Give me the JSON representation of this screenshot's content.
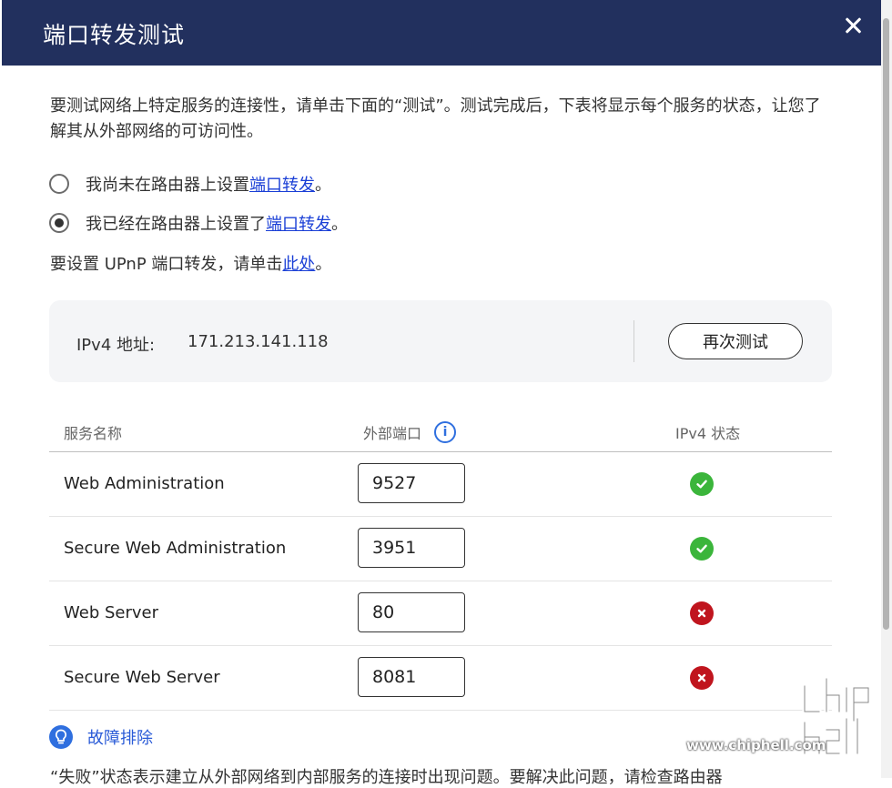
{
  "dialog": {
    "title": "端口转发测试"
  },
  "description": "要测试网络上特定服务的连接性，请单击下面的“测试”。测试完成后，下表将显示每个服务的状态，让您了解其从外部网络的可访问性。",
  "options": [
    {
      "text": "我尚未在路由器上设置",
      "link": "端口转发",
      "suffix": "。",
      "selected": false
    },
    {
      "text": "我已经在路由器上设置了",
      "link": "端口转发",
      "suffix": "。",
      "selected": true
    }
  ],
  "upnp": {
    "text": "要设置 UPnP 端口转发，请单击",
    "link": "此处",
    "suffix": "。"
  },
  "ip": {
    "label": "IPv4 地址:",
    "value": "171.213.141.118",
    "retest_label": "再次测试"
  },
  "table": {
    "headers": {
      "name": "服务名称",
      "port": "外部端口",
      "status": "IPv4 状态"
    },
    "rows": [
      {
        "name": "Web Administration",
        "port": "9527",
        "status": "ok"
      },
      {
        "name": "Secure Web Administration",
        "port": "3951",
        "status": "ok"
      },
      {
        "name": "Web Server",
        "port": "80",
        "status": "fail"
      },
      {
        "name": "Secure Web Server",
        "port": "8081",
        "status": "fail"
      }
    ]
  },
  "troubleshoot": {
    "label": "故障排除"
  },
  "bottom_text": "“失败”状态表示建立从外部网络到内部服务的连接时出现问题。要解决此问题，请检查路由器",
  "watermark": {
    "text": "www.chiphell.com"
  },
  "colors": {
    "header": "#22305e",
    "link": "#1a3fd6",
    "ok": "#3bb53b",
    "fail": "#c0151e",
    "accent": "#2f6fdf"
  },
  "icons": {
    "close": "close-icon",
    "info": "info-icon",
    "ok": "check-circle-icon",
    "fail": "x-circle-icon",
    "troubleshoot": "lightbulb-icon"
  }
}
